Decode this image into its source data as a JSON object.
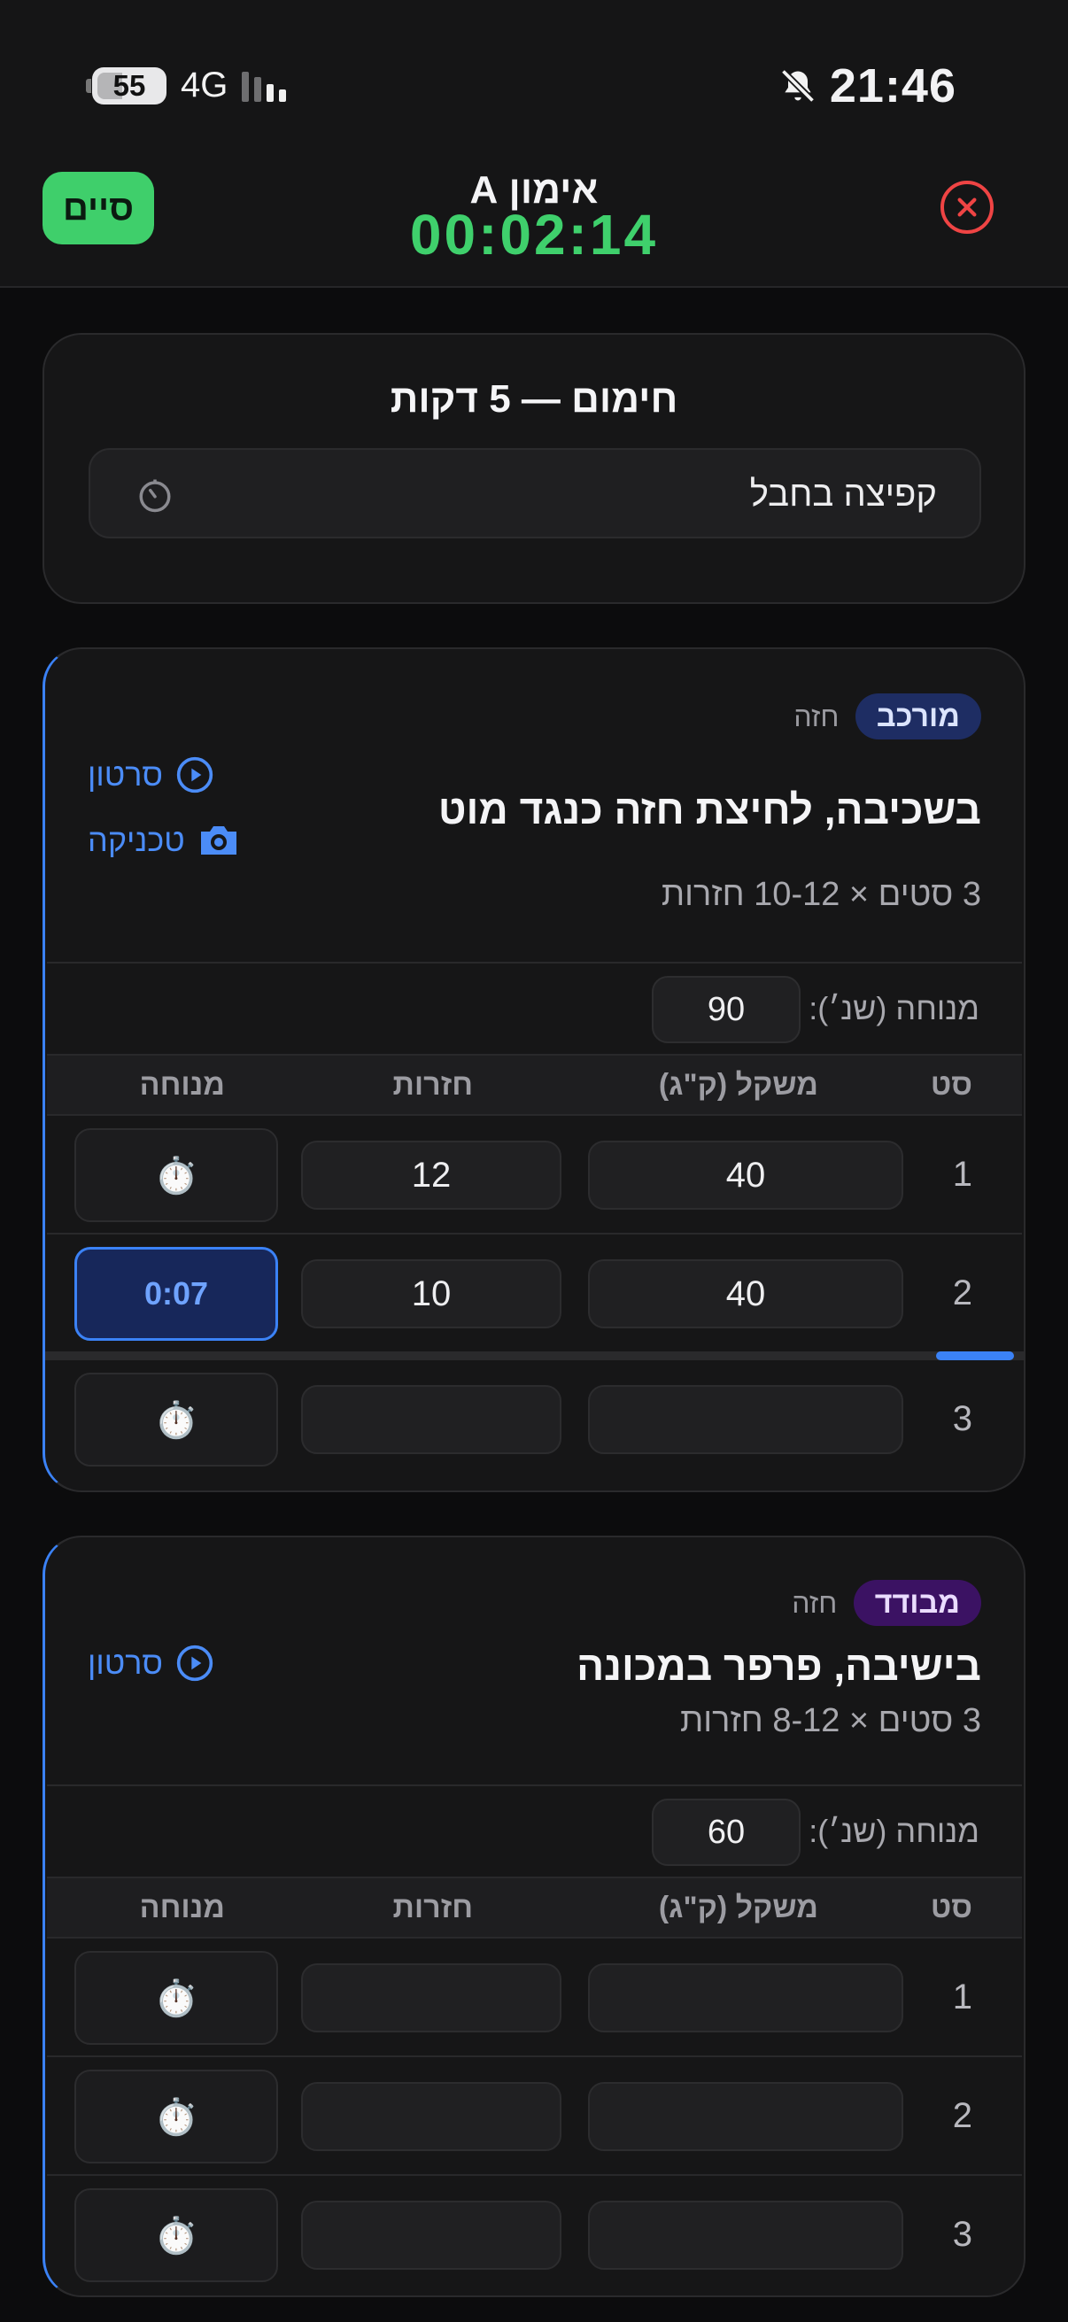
{
  "status_bar": {
    "battery": "55",
    "network": "4G",
    "time": "21:46"
  },
  "header": {
    "title": "אימון A",
    "timer": "00:02:14",
    "finish_label": "סיים",
    "close_icon": "close-circle-icon"
  },
  "warmup": {
    "title": "חימום — 5 דקות",
    "item": "קפיצה בחבל",
    "icon": "timer-icon"
  },
  "table_headers": {
    "set": "סט",
    "weight": "משקל (ק\"ג)",
    "reps": "חזרות",
    "rest": "מנוחה"
  },
  "rest_label": "מנוחה (שנ׳):",
  "exercises": [
    {
      "badge": "מורכב",
      "muscle": "חזה",
      "name": "בשכיבה, לחיצת חזה כנגד מוט",
      "sets_info": "3 סטים × 10-12 חזרות",
      "video_label": "סרטון",
      "technique_label": "טכניקה",
      "rest_seconds": "90",
      "progress": 0.08,
      "sets": [
        {
          "num": "1",
          "weight": "40",
          "reps": "12",
          "rest": "⏱️"
        },
        {
          "num": "2",
          "weight": "40",
          "reps": "10",
          "rest": "0:07"
        },
        {
          "num": "3",
          "weight": "",
          "reps": "",
          "rest": "⏱️"
        }
      ]
    },
    {
      "badge": "מבודד",
      "muscle": "חזה",
      "name": "בישיבה, פרפר במכונה",
      "sets_info": "3 סטים × 8-12 חזרות",
      "video_label": "סרטון",
      "rest_seconds": "60",
      "sets": [
        {
          "num": "1",
          "weight": "",
          "reps": "",
          "rest": "⏱️"
        },
        {
          "num": "2",
          "weight": "",
          "reps": "",
          "rest": "⏱️"
        },
        {
          "num": "3",
          "weight": "",
          "reps": "",
          "rest": "⏱️"
        }
      ]
    }
  ],
  "colors": {
    "accent_green": "#3fcf6b",
    "accent_blue": "#3b82f6",
    "danger": "#ef4444"
  }
}
